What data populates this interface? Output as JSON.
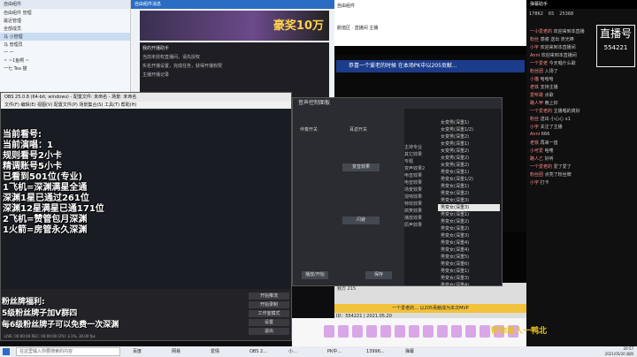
{
  "qq": {
    "title": "自由组件",
    "rows": [
      "自由组件 管理",
      "最近管理",
      "全部成员",
      "马 小管理",
      "马 管理员",
      "一 一",
      "~ ~1鱼啊 ~",
      "一七 Tea 猫"
    ]
  },
  "chat": {
    "title": "自由组件消息",
    "banner_text": "豪奖10万",
    "tip_title": "我的开播助手",
    "tip_line1": "当前未授权直播间，请先授权",
    "tip_line2": "实名开播设置，完成任务，获得开播权限",
    "tip_line3": "主播开播记录"
  },
  "live": {
    "header_title": "自由组件",
    "tabs": "颜值区 · 直播间 主播",
    "gift_notice": "恭喜一个爱老的时候 在本场PK中以205贡献...",
    "mvp_notice": "一个爱老的... 以205贡献成为本次MVP",
    "room_id": "ID：554221 | 2021.05.20",
    "footer": "我方 215"
  },
  "right": {
    "title": "弹幕助手",
    "counts": [
      "17862",
      "65",
      "25368"
    ],
    "logo_text": "直播号",
    "logo_num": "554221",
    "danmu": [
      {
        "user": "一小爱老的",
        "text": "欢迎来到本直播"
      },
      {
        "user": "粉丝",
        "text": "感谢 送出 荧光棒"
      },
      {
        "user": "小宇",
        "text": "欢迎来到本直播间"
      },
      {
        "user": "Anni",
        "text": "欢迎来到本直播间"
      },
      {
        "user": "一个爱老",
        "text": "今天唱什么歌"
      },
      {
        "user": "粉丝团",
        "text": "入场了"
      },
      {
        "user": "小猫",
        "text": "哈哈哈"
      },
      {
        "user": "老铁",
        "text": "支持主播"
      },
      {
        "user": "爱听歌",
        "text": "点歌"
      },
      {
        "user": "路人甲",
        "text": "晚上好"
      },
      {
        "user": "一个爱老的",
        "text": "主播唱的真好"
      },
      {
        "user": "粉丝",
        "text": "送出 小心心 x1"
      },
      {
        "user": "小宇",
        "text": "关注了主播"
      },
      {
        "user": "Anni",
        "text": "666"
      },
      {
        "user": "老铁",
        "text": "再来一首"
      },
      {
        "user": "小可爱",
        "text": "哈喽"
      },
      {
        "user": "路人乙",
        "text": "好听"
      },
      {
        "user": "一个爱老的",
        "text": "爱了爱了"
      },
      {
        "user": "粉丝团",
        "text": "点亮了粉丝牌"
      },
      {
        "user": "小宇",
        "text": "打卡"
      }
    ]
  },
  "obs": {
    "title": "OBS 25.0.8 (64-bit, windows) - 配置文件: 未命名 - 场景: 未命名",
    "menu": "文件(F)  编辑(E)  视图(V)  配置文件(P)  场景集合(S)  工具(T)  帮助(H)",
    "overlay": [
      "当前看号:",
      "当前演唱：1",
      "规则看号2小卡",
      "精调账号5小卡",
      "已看到501位(专业)",
      "1飞机=深渊满星全通",
      "深渊1星已通过261位",
      "深渊12星满星已通171位",
      "2飞机=赞管包月深渊",
      "1火箭=房管永久深渊"
    ],
    "fans": [
      "粉丝牌福利:",
      "5级粉丝牌子加V群四",
      "每6级粉丝牌子可以免费一次深渊"
    ],
    "controls": [
      "开始推流",
      "开始录制",
      "工作室模式",
      "设置",
      "退出"
    ],
    "status": "LIVE: 00:00:00  REC: 00:00:00  CPU: 3.1%, 30.00 fps"
  },
  "voice": {
    "title": "音声控制面板",
    "mic_label": "伴奏开关",
    "ear_label": "耳返开关",
    "btn1": "变音效果",
    "btn2": "闪避",
    "btn3": "播放/开始",
    "btn4": "保存",
    "categories": [
      "主持专业",
      "其它效果",
      "专题",
      "变声效果2",
      "电音效果",
      "电音效果",
      "场景效果",
      "混响效果",
      "特效效果",
      "搞笑效果",
      "播放效果",
      "原声效果"
    ],
    "items": [
      "女变男(深重1)",
      "女变男(深重1/2)",
      "女变男(深重2)",
      "女变男(深重1)",
      "女变男(深重2)",
      "女变男(深重2)",
      "女变男(深重2)",
      "男变女(深重1)",
      "男变女(深重1/2)",
      "男变女(深重1)",
      "男变女(深重2)",
      "男变女(深重3)",
      "男变女(深重3)",
      "男变女(深重1)",
      "男变女(深重2)",
      "男变女(深重2)",
      "男变女(深重3)",
      "男变女(深重4)",
      "男变女(深重4)",
      "男变女(深重5)",
      "男变女(深重6)",
      "男变女(深重1)",
      "男变女(深重3)",
      "男变女(深重4)"
    ],
    "selected_index": 12
  },
  "taskbar": {
    "search_placeholder": "在这里输入你要搜索的内容",
    "items": [
      "百度",
      "网易",
      "爱情",
      "OBS 2...",
      "小…",
      "PK中…",
      "13996...",
      "弹幕"
    ],
    "time": "20:57",
    "date": "2021/05/20 周四"
  },
  "gifts": {
    "jiezou_text": "帮你着人一鸭北"
  }
}
